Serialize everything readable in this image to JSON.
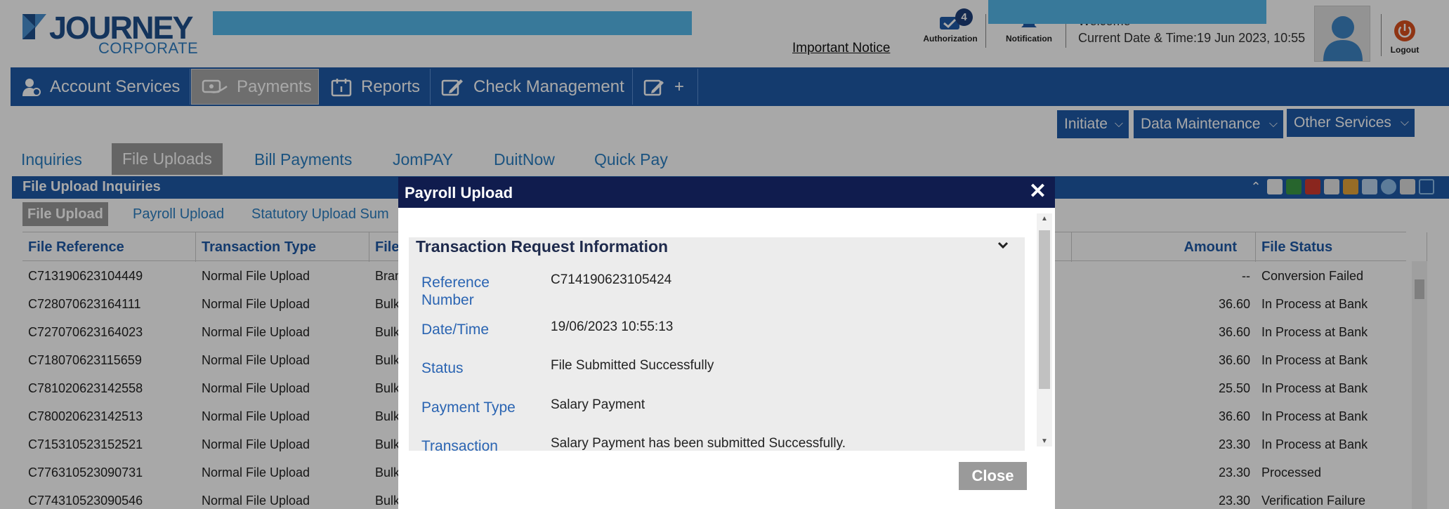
{
  "header": {
    "logo_main": "JOURNEY",
    "logo_sub": "CORPORATE",
    "important_notice": "Important Notice",
    "authorization_label": "Authorization",
    "authorization_count": "4",
    "notification_label": "Notification",
    "welcome_text": "Welcome",
    "current_datetime": "Current Date & Time:19 Jun 2023, 10:55",
    "logout_label": "Logout"
  },
  "main_nav": {
    "items": [
      {
        "label": "Account Services",
        "icon": "user-icon"
      },
      {
        "label": "Payments",
        "icon": "payments-icon"
      },
      {
        "label": "Reports",
        "icon": "reports-icon"
      },
      {
        "label": "Check Management",
        "icon": "cheque-icon"
      },
      {
        "label": "+",
        "icon": "add-cheque-icon"
      }
    ],
    "active": "Payments"
  },
  "action_menus": {
    "initiate": "Initiate",
    "data_maintenance": "Data Maintenance",
    "other_services": "Other Services"
  },
  "sub_tabs": {
    "items": [
      "Inquiries",
      "File Uploads",
      "Bill Payments",
      "JomPAY",
      "DuitNow",
      "Quick Pay"
    ],
    "active": "File Uploads"
  },
  "panel": {
    "title": "File Upload Inquiries",
    "tabs": [
      "File Upload",
      "Payroll Upload",
      "Statutory Upload Sum"
    ],
    "active_tab": "File Upload",
    "columns": {
      "file_reference": "File Reference",
      "transaction_type": "Transaction Type",
      "file": "File",
      "amount": "Amount",
      "file_status": "File Status"
    },
    "rows": [
      {
        "ref": "C713190623104449",
        "type": "Normal File Upload",
        "file": "Bran",
        "amount": "--",
        "status": "Conversion Failed"
      },
      {
        "ref": "C728070623164111",
        "type": "Normal File Upload",
        "file": "Bulk",
        "amount": "36.60",
        "status": "In Process at Bank"
      },
      {
        "ref": "C727070623164023",
        "type": "Normal File Upload",
        "file": "Bulk",
        "amount": "36.60",
        "status": "In Process at Bank"
      },
      {
        "ref": "C718070623115659",
        "type": "Normal File Upload",
        "file": "Bulk",
        "amount": "36.60",
        "status": "In Process at Bank"
      },
      {
        "ref": "C781020623142558",
        "type": "Normal File Upload",
        "file": "Bulk",
        "amount": "25.50",
        "status": "In Process at Bank"
      },
      {
        "ref": "C780020623142513",
        "type": "Normal File Upload",
        "file": "Bulk",
        "amount": "36.60",
        "status": "In Process at Bank"
      },
      {
        "ref": "C715310523152521",
        "type": "Normal File Upload",
        "file": "Bulk",
        "amount": "23.30",
        "status": "In Process at Bank"
      },
      {
        "ref": "C776310523090731",
        "type": "Normal File Upload",
        "file": "Bulk",
        "amount": "23.30",
        "status": "Processed"
      },
      {
        "ref": "C774310523090546",
        "type": "Normal File Upload",
        "file": "Bulk",
        "amount": "23.30",
        "status": "Verification Failure"
      }
    ]
  },
  "modal": {
    "title": "Payroll Upload",
    "section_title": "Transaction Request Information",
    "fields": {
      "reference_label_1": "Reference",
      "reference_label_2": "Number",
      "reference_value": "C714190623105424",
      "datetime_label": "Date/Time",
      "datetime_value": "19/06/2023 10:55:13",
      "status_label": "Status",
      "status_value": "File Submitted Successfully",
      "payment_type_label": "Payment Type",
      "payment_type_value": "Salary Payment",
      "transaction_label": "Transaction",
      "transaction_value": "Salary Payment has been submitted Successfully."
    },
    "close_label": "Close"
  },
  "colors": {
    "nav_blue": "#1f5aa8",
    "modal_header": "#101c4e",
    "link_blue": "#2a7fc3",
    "mask_blue": "#56b8ea"
  }
}
